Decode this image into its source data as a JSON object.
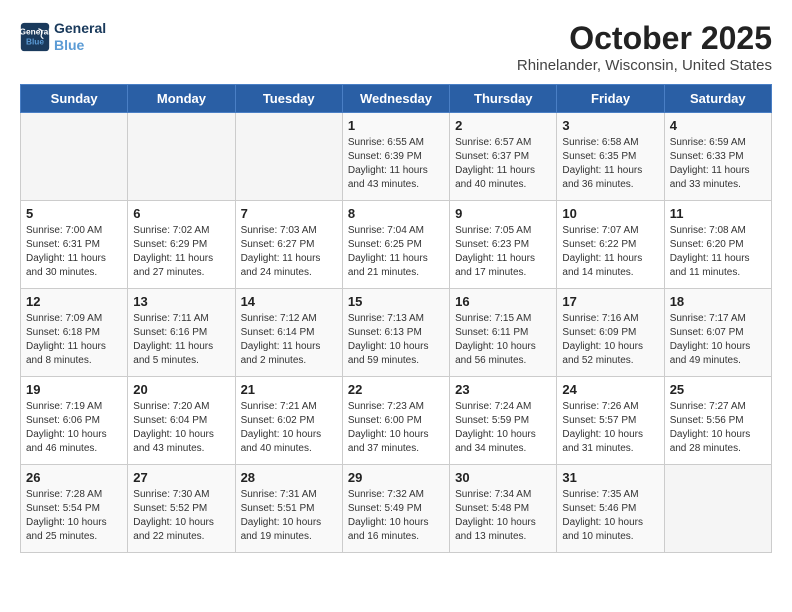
{
  "header": {
    "logo_line1": "General",
    "logo_line2": "Blue",
    "month": "October 2025",
    "location": "Rhinelander, Wisconsin, United States"
  },
  "weekdays": [
    "Sunday",
    "Monday",
    "Tuesday",
    "Wednesday",
    "Thursday",
    "Friday",
    "Saturday"
  ],
  "weeks": [
    [
      {
        "day": "",
        "detail": ""
      },
      {
        "day": "",
        "detail": ""
      },
      {
        "day": "",
        "detail": ""
      },
      {
        "day": "1",
        "detail": "Sunrise: 6:55 AM\nSunset: 6:39 PM\nDaylight: 11 hours\nand 43 minutes."
      },
      {
        "day": "2",
        "detail": "Sunrise: 6:57 AM\nSunset: 6:37 PM\nDaylight: 11 hours\nand 40 minutes."
      },
      {
        "day": "3",
        "detail": "Sunrise: 6:58 AM\nSunset: 6:35 PM\nDaylight: 11 hours\nand 36 minutes."
      },
      {
        "day": "4",
        "detail": "Sunrise: 6:59 AM\nSunset: 6:33 PM\nDaylight: 11 hours\nand 33 minutes."
      }
    ],
    [
      {
        "day": "5",
        "detail": "Sunrise: 7:00 AM\nSunset: 6:31 PM\nDaylight: 11 hours\nand 30 minutes."
      },
      {
        "day": "6",
        "detail": "Sunrise: 7:02 AM\nSunset: 6:29 PM\nDaylight: 11 hours\nand 27 minutes."
      },
      {
        "day": "7",
        "detail": "Sunrise: 7:03 AM\nSunset: 6:27 PM\nDaylight: 11 hours\nand 24 minutes."
      },
      {
        "day": "8",
        "detail": "Sunrise: 7:04 AM\nSunset: 6:25 PM\nDaylight: 11 hours\nand 21 minutes."
      },
      {
        "day": "9",
        "detail": "Sunrise: 7:05 AM\nSunset: 6:23 PM\nDaylight: 11 hours\nand 17 minutes."
      },
      {
        "day": "10",
        "detail": "Sunrise: 7:07 AM\nSunset: 6:22 PM\nDaylight: 11 hours\nand 14 minutes."
      },
      {
        "day": "11",
        "detail": "Sunrise: 7:08 AM\nSunset: 6:20 PM\nDaylight: 11 hours\nand 11 minutes."
      }
    ],
    [
      {
        "day": "12",
        "detail": "Sunrise: 7:09 AM\nSunset: 6:18 PM\nDaylight: 11 hours\nand 8 minutes."
      },
      {
        "day": "13",
        "detail": "Sunrise: 7:11 AM\nSunset: 6:16 PM\nDaylight: 11 hours\nand 5 minutes."
      },
      {
        "day": "14",
        "detail": "Sunrise: 7:12 AM\nSunset: 6:14 PM\nDaylight: 11 hours\nand 2 minutes."
      },
      {
        "day": "15",
        "detail": "Sunrise: 7:13 AM\nSunset: 6:13 PM\nDaylight: 10 hours\nand 59 minutes."
      },
      {
        "day": "16",
        "detail": "Sunrise: 7:15 AM\nSunset: 6:11 PM\nDaylight: 10 hours\nand 56 minutes."
      },
      {
        "day": "17",
        "detail": "Sunrise: 7:16 AM\nSunset: 6:09 PM\nDaylight: 10 hours\nand 52 minutes."
      },
      {
        "day": "18",
        "detail": "Sunrise: 7:17 AM\nSunset: 6:07 PM\nDaylight: 10 hours\nand 49 minutes."
      }
    ],
    [
      {
        "day": "19",
        "detail": "Sunrise: 7:19 AM\nSunset: 6:06 PM\nDaylight: 10 hours\nand 46 minutes."
      },
      {
        "day": "20",
        "detail": "Sunrise: 7:20 AM\nSunset: 6:04 PM\nDaylight: 10 hours\nand 43 minutes."
      },
      {
        "day": "21",
        "detail": "Sunrise: 7:21 AM\nSunset: 6:02 PM\nDaylight: 10 hours\nand 40 minutes."
      },
      {
        "day": "22",
        "detail": "Sunrise: 7:23 AM\nSunset: 6:00 PM\nDaylight: 10 hours\nand 37 minutes."
      },
      {
        "day": "23",
        "detail": "Sunrise: 7:24 AM\nSunset: 5:59 PM\nDaylight: 10 hours\nand 34 minutes."
      },
      {
        "day": "24",
        "detail": "Sunrise: 7:26 AM\nSunset: 5:57 PM\nDaylight: 10 hours\nand 31 minutes."
      },
      {
        "day": "25",
        "detail": "Sunrise: 7:27 AM\nSunset: 5:56 PM\nDaylight: 10 hours\nand 28 minutes."
      }
    ],
    [
      {
        "day": "26",
        "detail": "Sunrise: 7:28 AM\nSunset: 5:54 PM\nDaylight: 10 hours\nand 25 minutes."
      },
      {
        "day": "27",
        "detail": "Sunrise: 7:30 AM\nSunset: 5:52 PM\nDaylight: 10 hours\nand 22 minutes."
      },
      {
        "day": "28",
        "detail": "Sunrise: 7:31 AM\nSunset: 5:51 PM\nDaylight: 10 hours\nand 19 minutes."
      },
      {
        "day": "29",
        "detail": "Sunrise: 7:32 AM\nSunset: 5:49 PM\nDaylight: 10 hours\nand 16 minutes."
      },
      {
        "day": "30",
        "detail": "Sunrise: 7:34 AM\nSunset: 5:48 PM\nDaylight: 10 hours\nand 13 minutes."
      },
      {
        "day": "31",
        "detail": "Sunrise: 7:35 AM\nSunset: 5:46 PM\nDaylight: 10 hours\nand 10 minutes."
      },
      {
        "day": "",
        "detail": ""
      }
    ]
  ]
}
